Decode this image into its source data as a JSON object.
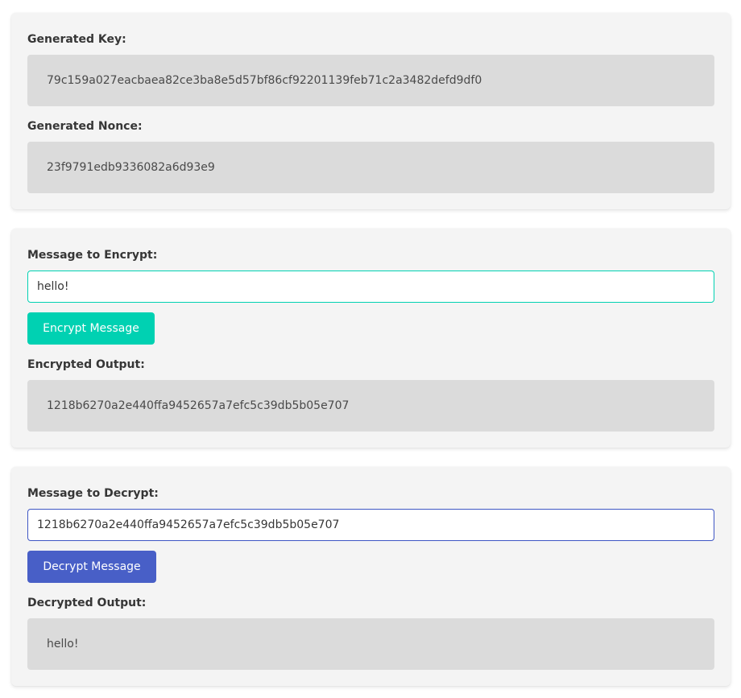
{
  "keys": {
    "key_label": "Generated Key:",
    "key_value": "79c159a027eacbaea82ce3ba8e5d57bf86cf92201139feb71c2a3482defd9df0",
    "nonce_label": "Generated Nonce:",
    "nonce_value": "23f9791edb9336082a6d93e9"
  },
  "encrypt": {
    "input_label": "Message to Encrypt:",
    "input_value": "hello!",
    "button_label": "Encrypt Message",
    "output_label": "Encrypted Output:",
    "output_value": "1218b6270a2e440ffa9452657a7efc5c39db5b05e707"
  },
  "decrypt": {
    "input_label": "Message to Decrypt:",
    "input_value": "1218b6270a2e440ffa9452657a7efc5c39db5b05e707",
    "button_label": "Decrypt Message",
    "output_label": "Decrypted Output:",
    "output_value": "hello!"
  },
  "colors": {
    "encrypt_accent": "#00d1b2",
    "decrypt_accent": "#485fc7",
    "card_background": "#f4f4f4",
    "output_background": "#dbdbdb"
  }
}
